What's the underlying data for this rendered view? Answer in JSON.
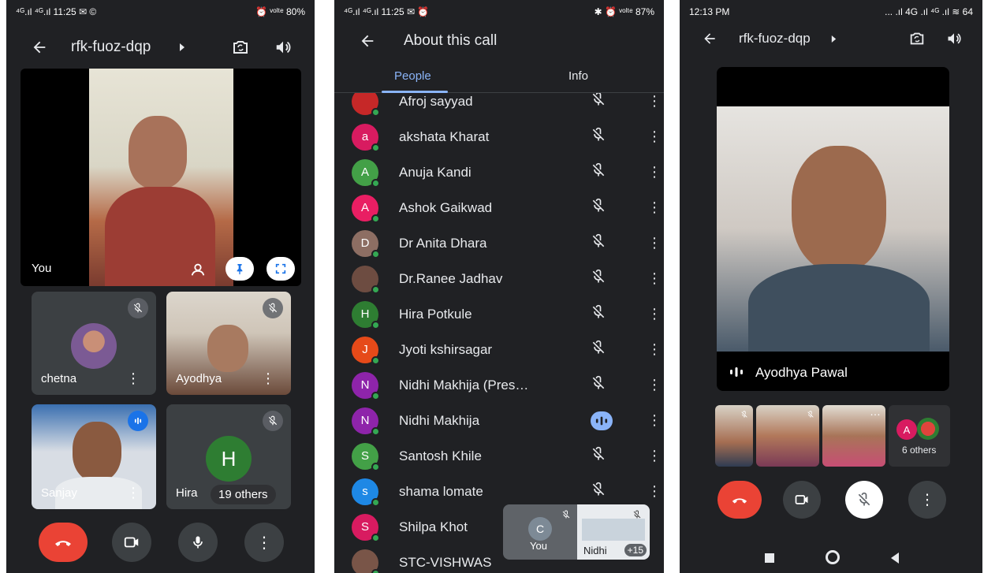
{
  "phone1": {
    "status": {
      "left": "⁴ᴳ.ıl ⁴ᴳ.ıl 11:25 ✉ ©",
      "right": "⏰ ᵛᵒˡᵗᵉ 80%"
    },
    "meeting_code": "rfk-fuoz-dqp",
    "self_label": "You",
    "tiles": [
      {
        "name": "chetna"
      },
      {
        "name": "Ayodhya"
      },
      {
        "name": "Sanjay"
      },
      {
        "name": "Hira",
        "initial": "H",
        "others": "19 others"
      }
    ]
  },
  "phone2": {
    "status": {
      "left": "⁴ᴳ.ıl ⁴ᴳ.ıl 11:25 ✉ ⏰",
      "right": "✱ ⏰ ᵛᵒˡᵗᵉ 87%"
    },
    "title": "About this call",
    "tabs": [
      "People",
      "Info"
    ],
    "people": [
      {
        "name": "Afroj sayyad",
        "initial": "",
        "color": "#c62828",
        "mic": "muted"
      },
      {
        "name": "akshata Kharat",
        "initial": "a",
        "color": "#d81b60",
        "mic": "muted"
      },
      {
        "name": "Anuja Kandi",
        "initial": "A",
        "color": "#43a047",
        "mic": "muted"
      },
      {
        "name": "Ashok Gaikwad",
        "initial": "A",
        "color": "#e91e63",
        "mic": "muted"
      },
      {
        "name": "Dr Anita Dhara",
        "initial": "D",
        "color": "#8d6e63",
        "mic": "muted"
      },
      {
        "name": "Dr.Ranee Jadhav",
        "initial": "",
        "color": "#6d4c41",
        "mic": "muted"
      },
      {
        "name": "Hira Potkule",
        "initial": "H",
        "color": "#2e7d32",
        "mic": "muted"
      },
      {
        "name": "Jyoti kshirsagar",
        "initial": "J",
        "color": "#e64a19",
        "mic": "muted"
      },
      {
        "name": "Nidhi Makhija (Pres…",
        "initial": "N",
        "color": "#8e24aa",
        "mic": "muted"
      },
      {
        "name": "Nidhi Makhija",
        "initial": "N",
        "color": "#8e24aa",
        "mic": "speaking"
      },
      {
        "name": "Santosh Khile",
        "initial": "S",
        "color": "#43a047",
        "mic": "muted"
      },
      {
        "name": "shama lomate",
        "initial": "s",
        "color": "#1e88e5",
        "mic": "muted"
      },
      {
        "name": "Shilpa Khot",
        "initial": "S",
        "color": "#d81b60",
        "mic": ""
      },
      {
        "name": "STC-VISHWAS",
        "initial": "",
        "color": "#795548",
        "mic": ""
      }
    ],
    "pip": {
      "you_initial": "C",
      "you_label": "You",
      "other_label": "Nidhi",
      "count": "+15"
    }
  },
  "phone3": {
    "status": {
      "left": "12:13 PM",
      "right": "... .ıl 4G .ıl ⁴ᴳ .ıl ≋ 64"
    },
    "meeting_code": "rfk-fuoz-dqp",
    "speaker": "Ayodhya Pawal",
    "others_label": "6 others",
    "others_initial": "A"
  }
}
